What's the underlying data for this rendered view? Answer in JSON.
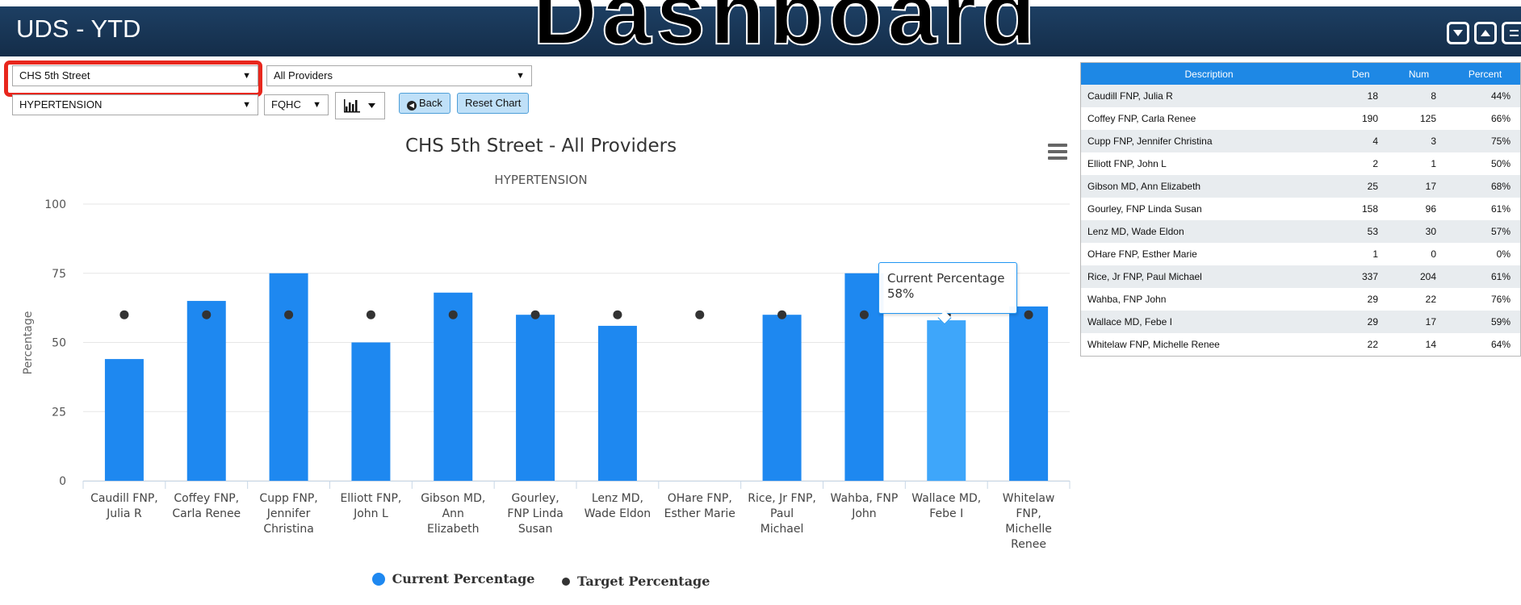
{
  "header": {
    "title": "UDS - YTD",
    "ghost_text": "Dashboard"
  },
  "filters": {
    "location": "CHS 5th Street",
    "provider": "All Providers",
    "measure": "HYPERTENSION",
    "type": "FQHC",
    "back_label": "Back",
    "reset_label": "Reset Chart"
  },
  "chart": {
    "title": "CHS 5th Street - All Providers",
    "subtitle": "HYPERTENSION",
    "ylabel": "Percentage",
    "yticks": [
      "0",
      "25",
      "50",
      "75",
      "100"
    ],
    "legend": [
      {
        "label": "Current Percentage",
        "color": "#1e88f0"
      },
      {
        "label": "Target Percentage",
        "color": "#333333"
      }
    ],
    "tooltip": {
      "series": "Current Percentage",
      "value": "58%"
    }
  },
  "chart_data": {
    "type": "bar",
    "title": "CHS 5th Street - All Providers",
    "subtitle": "HYPERTENSION",
    "xlabel": "",
    "ylabel": "Percentage",
    "ylim": [
      0,
      100
    ],
    "categories": [
      "Caudill FNP, Julia R",
      "Coffey FNP, Carla Renee",
      "Cupp FNP, Jennifer Christina",
      "Elliott FNP, John L",
      "Gibson MD, Ann Elizabeth",
      "Gourley, FNP Linda Susan",
      "Lenz MD, Wade Eldon",
      "OHare FNP, Esther Marie",
      "Rice, Jr FNP, Paul Michael",
      "Wahba, FNP John",
      "Wallace MD, Febe I",
      "Whitelaw FNP, Michelle Renee"
    ],
    "category_lines": [
      [
        "Caudill FNP,",
        "Julia R"
      ],
      [
        "Coffey FNP,",
        "Carla Renee"
      ],
      [
        "Cupp FNP,",
        "Jennifer",
        "Christina"
      ],
      [
        "Elliott FNP,",
        "John L"
      ],
      [
        "Gibson MD,",
        "Ann",
        "Elizabeth"
      ],
      [
        "Gourley,",
        "FNP Linda",
        "Susan"
      ],
      [
        "Lenz MD,",
        "Wade Eldon"
      ],
      [
        "OHare FNP,",
        "Esther Marie"
      ],
      [
        "Rice, Jr FNP,",
        "Paul",
        "Michael"
      ],
      [
        "Wahba, FNP",
        "John"
      ],
      [
        "Wallace MD,",
        "Febe I"
      ],
      [
        "Whitelaw",
        "FNP,",
        "Michelle",
        "Renee"
      ]
    ],
    "series": [
      {
        "name": "Current Percentage",
        "type": "bar",
        "color": "#1e88f0",
        "hover_color": "#3ea6fa",
        "values": [
          44,
          65,
          75,
          50,
          68,
          60,
          56,
          0,
          60,
          75,
          58,
          63
        ]
      },
      {
        "name": "Target Percentage",
        "type": "scatter",
        "color": "#333333",
        "values": [
          60,
          60,
          60,
          60,
          60,
          60,
          60,
          60,
          60,
          60,
          60,
          60
        ]
      }
    ],
    "highlighted_index": 10,
    "grid": true,
    "legend_position": "bottom-center"
  },
  "table": {
    "headers": [
      "Description",
      "Den",
      "Num",
      "Percent"
    ],
    "rows": [
      [
        "Caudill FNP, Julia R",
        "18",
        "8",
        "44%"
      ],
      [
        "Coffey FNP, Carla Renee",
        "190",
        "125",
        "66%"
      ],
      [
        "Cupp FNP, Jennifer Christina",
        "4",
        "3",
        "75%"
      ],
      [
        "Elliott FNP, John L",
        "2",
        "1",
        "50%"
      ],
      [
        "Gibson MD, Ann Elizabeth",
        "25",
        "17",
        "68%"
      ],
      [
        "Gourley, FNP Linda Susan",
        "158",
        "96",
        "61%"
      ],
      [
        "Lenz MD, Wade Eldon",
        "53",
        "30",
        "57%"
      ],
      [
        "OHare FNP, Esther Marie",
        "1",
        "0",
        "0%"
      ],
      [
        "Rice, Jr FNP, Paul Michael",
        "337",
        "204",
        "61%"
      ],
      [
        "Wahba, FNP John",
        "29",
        "22",
        "76%"
      ],
      [
        "Wallace MD, Febe I",
        "29",
        "17",
        "59%"
      ],
      [
        "Whitelaw FNP, Michelle Renee",
        "22",
        "14",
        "64%"
      ]
    ]
  },
  "icons": {
    "collapse": "collapse-icon",
    "expand": "expand-icon",
    "menu": "hamburger-menu-icon",
    "chart_type": "bar-chart-icon",
    "back": "arrow-left-circle-icon"
  }
}
